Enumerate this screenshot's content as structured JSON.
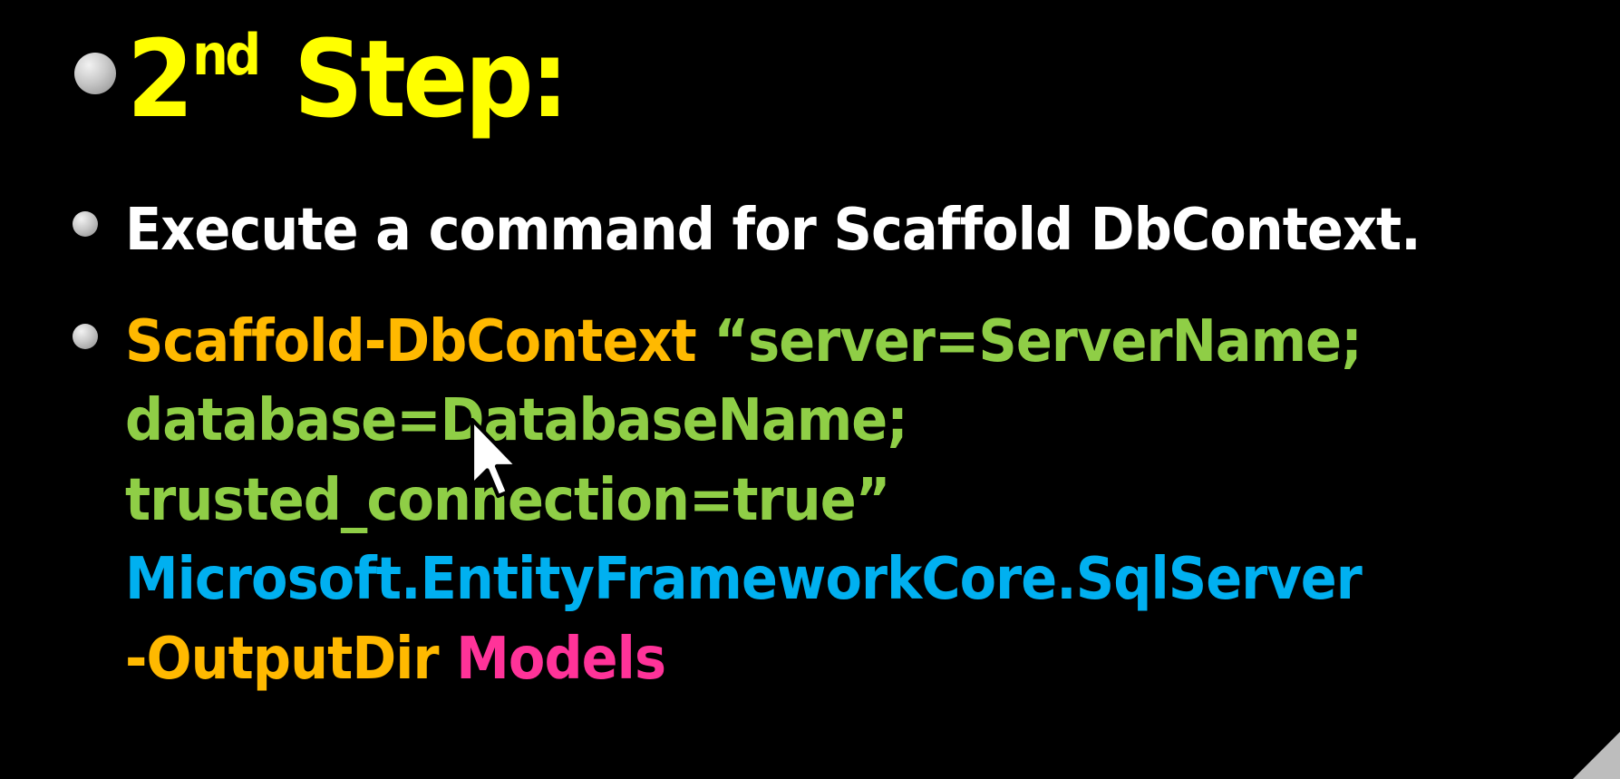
{
  "slide": {
    "title": {
      "number": "2",
      "superscript": "nd",
      "word": "Step:"
    },
    "bullet_1": "Execute a command for Scaffold DbContext.",
    "command": {
      "line1_cmd": "Scaffold-DbContext",
      "line1_arg": "“server=ServerName;",
      "line2": "database=DatabaseName;",
      "line3": "trusted_connection=true”",
      "line4": "Microsoft.EntityFrameworkCore.SqlServer",
      "line5_flag": "-OutputDir",
      "line5_value": "Models"
    }
  },
  "colors": {
    "background": "#000000",
    "title": "#ffff00",
    "text": "#ffffff",
    "command": "#ffb900",
    "string": "#8fce46",
    "provider": "#00b0f0",
    "value": "#ff3399"
  },
  "icons": {
    "cursor": "mouse-pointer-icon",
    "bullet": "bullet-dot-icon"
  }
}
